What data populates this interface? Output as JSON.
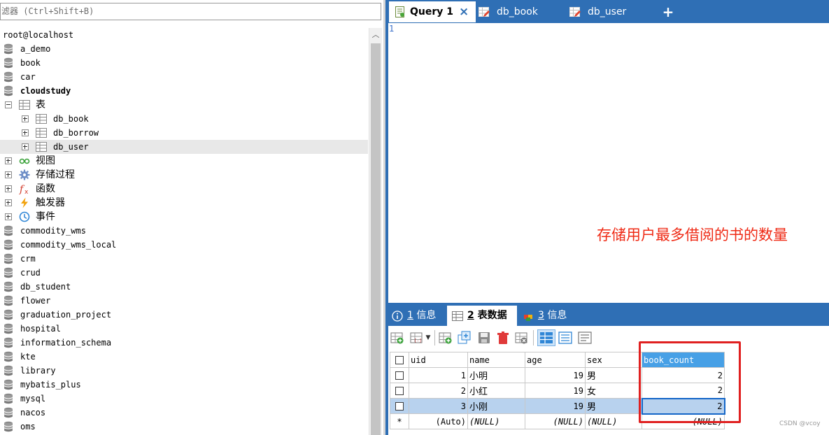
{
  "filter": {
    "text": "滤器 (Ctrl+Shift+B)"
  },
  "tree": {
    "connection": "root@localhost",
    "databases_top": [
      {
        "name": "a_demo",
        "bold": false
      },
      {
        "name": "book",
        "bold": false
      },
      {
        "name": "car",
        "bold": false
      },
      {
        "name": "cloudstudy",
        "bold": true
      }
    ],
    "tables_folder": "表",
    "tables": [
      "db_book",
      "db_borrow",
      "db_user"
    ],
    "selected_table": "db_user",
    "folders": [
      {
        "label": "视图",
        "icon": "view-icon"
      },
      {
        "label": "存储过程",
        "icon": "gear-icon"
      },
      {
        "label": "函数",
        "icon": "function-icon"
      },
      {
        "label": "触发器",
        "icon": "lightning-icon"
      },
      {
        "label": "事件",
        "icon": "clock-icon"
      }
    ],
    "databases_bottom": [
      "commodity_wms",
      "commodity_wms_local",
      "crm",
      "crud",
      "db_student",
      "flower",
      "graduation_project",
      "hospital",
      "information_schema",
      "kte",
      "library",
      "mybatis_plus",
      "mysql",
      "nacos",
      "oms"
    ]
  },
  "tabs": {
    "items": [
      {
        "label": "Query 1",
        "active": true,
        "icon": "query-icon"
      },
      {
        "label": "db_book",
        "active": false,
        "icon": "table-edit-icon"
      },
      {
        "label": "db_user",
        "active": false,
        "icon": "table-edit-icon"
      }
    ],
    "close_glyph": "×",
    "add_glyph": "+"
  },
  "editor": {
    "line_number": "1",
    "annotation": "存储用户最多借阅的书的数量"
  },
  "result_tabs": [
    {
      "num": "1",
      "label": "信息",
      "active": false,
      "icon": "info-icon"
    },
    {
      "num": "2",
      "label": "表数据",
      "active": true,
      "icon": "grid-icon"
    },
    {
      "num": "3",
      "label": "信息",
      "active": false,
      "icon": "cube-icon"
    }
  ],
  "grid": {
    "columns": [
      "uid",
      "name",
      "age",
      "sex",
      "book_count"
    ],
    "rows": [
      {
        "uid": "1",
        "name": "小明",
        "age": "19",
        "sex": "男",
        "book_count": "2"
      },
      {
        "uid": "2",
        "name": "小红",
        "age": "19",
        "sex": "女",
        "book_count": "2"
      },
      {
        "uid": "3",
        "name": "小刚",
        "age": "19",
        "sex": "男",
        "book_count": "2"
      }
    ],
    "new_row": {
      "marker": "*",
      "uid": "(Auto)",
      "name": "(NULL)",
      "age": "(NULL)",
      "sex": "(NULL)",
      "book_count": "(NULL)"
    },
    "selected_row": 3,
    "highlighted_column": "book_count"
  },
  "watermark": "CSDN @vcoy",
  "colors": {
    "accent": "#2f6fb5",
    "annotation": "#ef2a15",
    "highlight_box": "#e02020"
  }
}
